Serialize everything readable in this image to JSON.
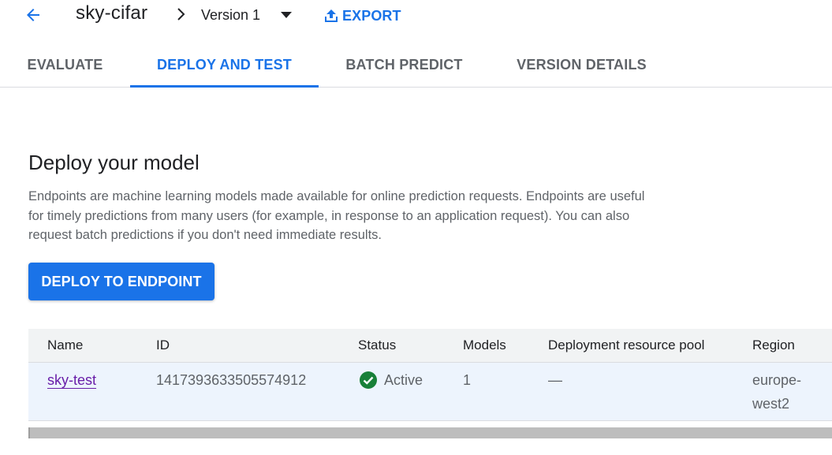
{
  "header": {
    "model_name": "sky-cifar",
    "version_label": "Version 1",
    "export_label": "EXPORT"
  },
  "tabs": [
    {
      "label": "EVALUATE",
      "active": false
    },
    {
      "label": "DEPLOY AND TEST",
      "active": true
    },
    {
      "label": "BATCH PREDICT",
      "active": false
    },
    {
      "label": "VERSION DETAILS",
      "active": false
    }
  ],
  "main": {
    "heading": "Deploy your model",
    "description": "Endpoints are machine learning models made available for online prediction requests. Endpoints are useful for timely predictions from many users (for example, in response to an application request). You can also request batch predictions if you don't need immediate results.",
    "deploy_button_label": "DEPLOY TO ENDPOINT"
  },
  "table": {
    "columns": [
      "Name",
      "ID",
      "Status",
      "Models",
      "Deployment resource pool",
      "Region"
    ],
    "rows": [
      {
        "name": "sky-test",
        "id": "1417393633505574912",
        "status": "Active",
        "models": "1",
        "pool": "—",
        "region": "europe-west2"
      }
    ]
  },
  "colors": {
    "accent": "#1a73e8",
    "link_visited": "#681da8",
    "status_active": "#188038"
  },
  "icons": {
    "back": "arrow-back-icon",
    "separator": "chevron-right-icon",
    "dropdown": "caret-down-icon",
    "export": "upload-icon",
    "status": "check-circle-icon"
  }
}
